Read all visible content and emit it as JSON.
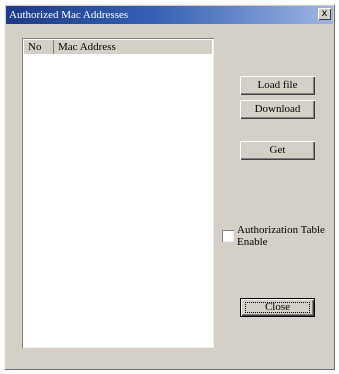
{
  "window": {
    "title": "Authorized Mac Addresses",
    "close_glyph": "x"
  },
  "list": {
    "columns": [
      "No",
      "Mac Address"
    ],
    "rows": []
  },
  "buttons": {
    "load_file": "Load file",
    "download": "Download",
    "get": "Get",
    "close": "Close"
  },
  "auth_table": {
    "label": "Authorization Table Enable",
    "checked": false
  }
}
